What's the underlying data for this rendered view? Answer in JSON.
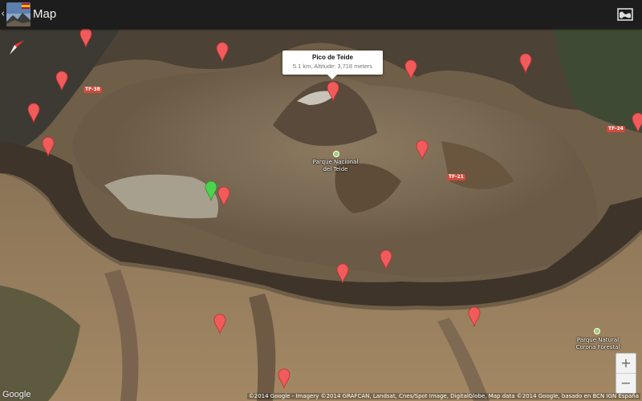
{
  "appbar": {
    "title": "Map",
    "back_glyph": "‹",
    "app_icon": "app-photo-icon-with-flag",
    "map_type_icon": "map-type-toggle-icon"
  },
  "info_window": {
    "title": "Pico de Teide",
    "subtitle": "5.1 km, Altitude: 3,718 meters"
  },
  "places": [
    {
      "name": "Parque Nacional del Teide"
    },
    {
      "name": "Parque Natural Corona Forestal"
    }
  ],
  "roads": [
    "TF-38",
    "TF-24",
    "TF-21"
  ],
  "markers": {
    "selected_color": "#f25b5b",
    "user_color": "#4cd44c",
    "default_color": "#f25b5b",
    "count": 19
  },
  "controls": {
    "zoom_in": "+",
    "zoom_out": "−"
  },
  "footer": {
    "logo": "Google",
    "attribution": "©2014 Google - Imagery ©2014 GRAFCAN, Landsat, Cnes/Spot Image, DigitalGlobe, Map data ©2014 Google, basado en BCN IGN España"
  },
  "colors": {
    "appbar_bg": "#1d1d1d",
    "marker_red": "#f25b5b",
    "marker_green": "#4cd44c"
  }
}
